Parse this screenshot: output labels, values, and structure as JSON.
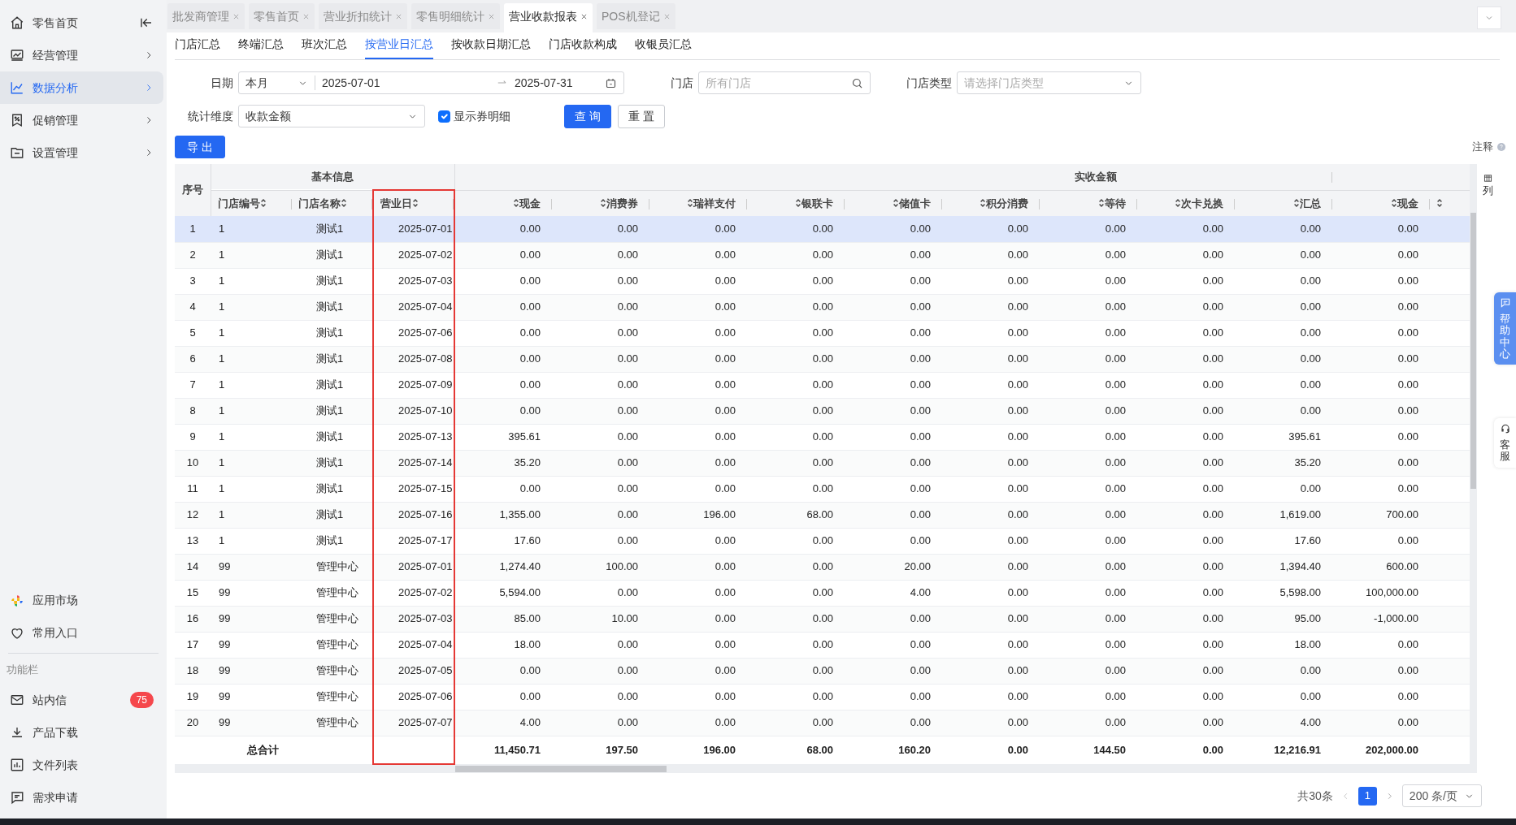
{
  "sidebar": {
    "items": [
      {
        "label": "零售首页",
        "expandable": false,
        "collapse_control": true,
        "selected": false
      },
      {
        "label": "经营管理",
        "expandable": true,
        "collapse_control": false,
        "selected": false
      },
      {
        "label": "数据分析",
        "expandable": true,
        "collapse_control": false,
        "selected": true
      },
      {
        "label": "促销管理",
        "expandable": true,
        "collapse_control": false,
        "selected": false
      },
      {
        "label": "设置管理",
        "expandable": true,
        "collapse_control": false,
        "selected": false
      }
    ],
    "tools": [
      {
        "label": "应用市场"
      },
      {
        "label": "常用入口"
      }
    ],
    "section_label": "功能栏",
    "feature_items": [
      {
        "label": "站内信",
        "badge": "75"
      },
      {
        "label": "产品下载"
      },
      {
        "label": "文件列表"
      },
      {
        "label": "需求申请"
      }
    ]
  },
  "open_tabs": [
    {
      "label": "批发商管理",
      "selected": false
    },
    {
      "label": "零售首页",
      "selected": false
    },
    {
      "label": "营业折扣统计",
      "selected": false
    },
    {
      "label": "零售明细统计",
      "selected": false
    },
    {
      "label": "营业收款报表",
      "selected": true
    },
    {
      "label": "POS机登记",
      "selected": false
    }
  ],
  "report_tabs": [
    {
      "label": "门店汇总",
      "selected": false
    },
    {
      "label": "终端汇总",
      "selected": false
    },
    {
      "label": "班次汇总",
      "selected": false
    },
    {
      "label": "按营业日汇总",
      "selected": true
    },
    {
      "label": "按收款日期汇总",
      "selected": false
    },
    {
      "label": "门店收款构成",
      "selected": false
    },
    {
      "label": "收银员汇总",
      "selected": false
    }
  ],
  "filters": {
    "date": {
      "label": "日期",
      "range": "本月",
      "start": "2025-07-01",
      "end": "2025-07-31"
    },
    "store": {
      "label": "门店",
      "placeholder": "所有门店"
    },
    "store_type": {
      "label": "门店类型",
      "placeholder": "请选择门店类型"
    },
    "dimension": {
      "label": "统计维度",
      "value": "收款金额"
    },
    "show_coupon_detail": {
      "label": "显示券明细",
      "checked": true
    },
    "query_button": "查 询",
    "reset_button": "重 置"
  },
  "export_button": "导 出",
  "note": "注释",
  "table": {
    "groups": [
      {
        "title": "基本信息"
      },
      {
        "title": "实收金额"
      }
    ],
    "columns": [
      {
        "label": "序号",
        "kind": "index",
        "highlighted": false
      },
      {
        "label": "门店编号",
        "kind": "text",
        "highlighted": false
      },
      {
        "label": "门店名称",
        "kind": "text",
        "highlighted": false
      },
      {
        "label": "营业日",
        "kind": "text",
        "highlighted": true
      },
      {
        "label": "现金",
        "kind": "amount",
        "highlighted": false
      },
      {
        "label": "消费券",
        "kind": "amount",
        "highlighted": false
      },
      {
        "label": "瑞祥支付",
        "kind": "amount",
        "highlighted": false
      },
      {
        "label": "银联卡",
        "kind": "amount",
        "highlighted": false
      },
      {
        "label": "储值卡",
        "kind": "amount",
        "highlighted": false
      },
      {
        "label": "积分消费",
        "kind": "amount",
        "highlighted": false
      },
      {
        "label": "等待",
        "kind": "amount",
        "highlighted": false
      },
      {
        "label": "次卡兑换",
        "kind": "amount",
        "highlighted": false
      },
      {
        "label": "汇总",
        "kind": "amount",
        "highlighted": false
      },
      {
        "label": "现金",
        "kind": "amount",
        "highlighted": false
      }
    ],
    "trailing_cut_column": true,
    "rows": [
      {
        "selected": true,
        "cells": [
          "1",
          "1",
          "测试1",
          "2025-07-01",
          "0.00",
          "0.00",
          "0.00",
          "0.00",
          "0.00",
          "0.00",
          "0.00",
          "0.00",
          "0.00",
          "0.00"
        ]
      },
      {
        "selected": false,
        "cells": [
          "2",
          "1",
          "测试1",
          "2025-07-02",
          "0.00",
          "0.00",
          "0.00",
          "0.00",
          "0.00",
          "0.00",
          "0.00",
          "0.00",
          "0.00",
          "0.00"
        ]
      },
      {
        "selected": false,
        "cells": [
          "3",
          "1",
          "测试1",
          "2025-07-03",
          "0.00",
          "0.00",
          "0.00",
          "0.00",
          "0.00",
          "0.00",
          "0.00",
          "0.00",
          "0.00",
          "0.00"
        ]
      },
      {
        "selected": false,
        "cells": [
          "4",
          "1",
          "测试1",
          "2025-07-04",
          "0.00",
          "0.00",
          "0.00",
          "0.00",
          "0.00",
          "0.00",
          "0.00",
          "0.00",
          "0.00",
          "0.00"
        ]
      },
      {
        "selected": false,
        "cells": [
          "5",
          "1",
          "测试1",
          "2025-07-06",
          "0.00",
          "0.00",
          "0.00",
          "0.00",
          "0.00",
          "0.00",
          "0.00",
          "0.00",
          "0.00",
          "0.00"
        ]
      },
      {
        "selected": false,
        "cells": [
          "6",
          "1",
          "测试1",
          "2025-07-08",
          "0.00",
          "0.00",
          "0.00",
          "0.00",
          "0.00",
          "0.00",
          "0.00",
          "0.00",
          "0.00",
          "0.00"
        ]
      },
      {
        "selected": false,
        "cells": [
          "7",
          "1",
          "测试1",
          "2025-07-09",
          "0.00",
          "0.00",
          "0.00",
          "0.00",
          "0.00",
          "0.00",
          "0.00",
          "0.00",
          "0.00",
          "0.00"
        ]
      },
      {
        "selected": false,
        "cells": [
          "8",
          "1",
          "测试1",
          "2025-07-10",
          "0.00",
          "0.00",
          "0.00",
          "0.00",
          "0.00",
          "0.00",
          "0.00",
          "0.00",
          "0.00",
          "0.00"
        ]
      },
      {
        "selected": false,
        "cells": [
          "9",
          "1",
          "测试1",
          "2025-07-13",
          "395.61",
          "0.00",
          "0.00",
          "0.00",
          "0.00",
          "0.00",
          "0.00",
          "0.00",
          "395.61",
          "0.00"
        ]
      },
      {
        "selected": false,
        "cells": [
          "10",
          "1",
          "测试1",
          "2025-07-14",
          "35.20",
          "0.00",
          "0.00",
          "0.00",
          "0.00",
          "0.00",
          "0.00",
          "0.00",
          "35.20",
          "0.00"
        ]
      },
      {
        "selected": false,
        "cells": [
          "11",
          "1",
          "测试1",
          "2025-07-15",
          "0.00",
          "0.00",
          "0.00",
          "0.00",
          "0.00",
          "0.00",
          "0.00",
          "0.00",
          "0.00",
          "0.00"
        ]
      },
      {
        "selected": false,
        "cells": [
          "12",
          "1",
          "测试1",
          "2025-07-16",
          "1,355.00",
          "0.00",
          "196.00",
          "68.00",
          "0.00",
          "0.00",
          "0.00",
          "0.00",
          "1,619.00",
          "700.00"
        ]
      },
      {
        "selected": false,
        "cells": [
          "13",
          "1",
          "测试1",
          "2025-07-17",
          "17.60",
          "0.00",
          "0.00",
          "0.00",
          "0.00",
          "0.00",
          "0.00",
          "0.00",
          "17.60",
          "0.00"
        ]
      },
      {
        "selected": false,
        "cells": [
          "14",
          "99",
          "管理中心",
          "2025-07-01",
          "1,274.40",
          "100.00",
          "0.00",
          "0.00",
          "20.00",
          "0.00",
          "0.00",
          "0.00",
          "1,394.40",
          "600.00"
        ]
      },
      {
        "selected": false,
        "cells": [
          "15",
          "99",
          "管理中心",
          "2025-07-02",
          "5,594.00",
          "0.00",
          "0.00",
          "0.00",
          "4.00",
          "0.00",
          "0.00",
          "0.00",
          "5,598.00",
          "100,000.00"
        ]
      },
      {
        "selected": false,
        "cells": [
          "16",
          "99",
          "管理中心",
          "2025-07-03",
          "85.00",
          "10.00",
          "0.00",
          "0.00",
          "0.00",
          "0.00",
          "0.00",
          "0.00",
          "95.00",
          "-1,000.00"
        ]
      },
      {
        "selected": false,
        "cells": [
          "17",
          "99",
          "管理中心",
          "2025-07-04",
          "18.00",
          "0.00",
          "0.00",
          "0.00",
          "0.00",
          "0.00",
          "0.00",
          "0.00",
          "18.00",
          "0.00"
        ]
      },
      {
        "selected": false,
        "cells": [
          "18",
          "99",
          "管理中心",
          "2025-07-05",
          "0.00",
          "0.00",
          "0.00",
          "0.00",
          "0.00",
          "0.00",
          "0.00",
          "0.00",
          "0.00",
          "0.00"
        ]
      },
      {
        "selected": false,
        "cells": [
          "19",
          "99",
          "管理中心",
          "2025-07-06",
          "0.00",
          "0.00",
          "0.00",
          "0.00",
          "0.00",
          "0.00",
          "0.00",
          "0.00",
          "0.00",
          "0.00"
        ]
      },
      {
        "selected": false,
        "cells": [
          "20",
          "99",
          "管理中心",
          "2025-07-07",
          "4.00",
          "0.00",
          "0.00",
          "0.00",
          "0.00",
          "0.00",
          "0.00",
          "0.00",
          "4.00",
          "0.00"
        ]
      }
    ],
    "total": {
      "label": "总合计",
      "values": [
        "11,450.71",
        "197.50",
        "196.00",
        "68.00",
        "160.20",
        "0.00",
        "144.50",
        "0.00",
        "12,216.91",
        "202,000.00"
      ]
    }
  },
  "column_settings": "列",
  "pagination": {
    "total": "共30条",
    "pages": [
      {
        "label": "1",
        "selected": true
      }
    ],
    "page_size": "200 条/页"
  },
  "side_tabs": [
    {
      "label": "帮助中心"
    },
    {
      "label": "客服"
    }
  ]
}
